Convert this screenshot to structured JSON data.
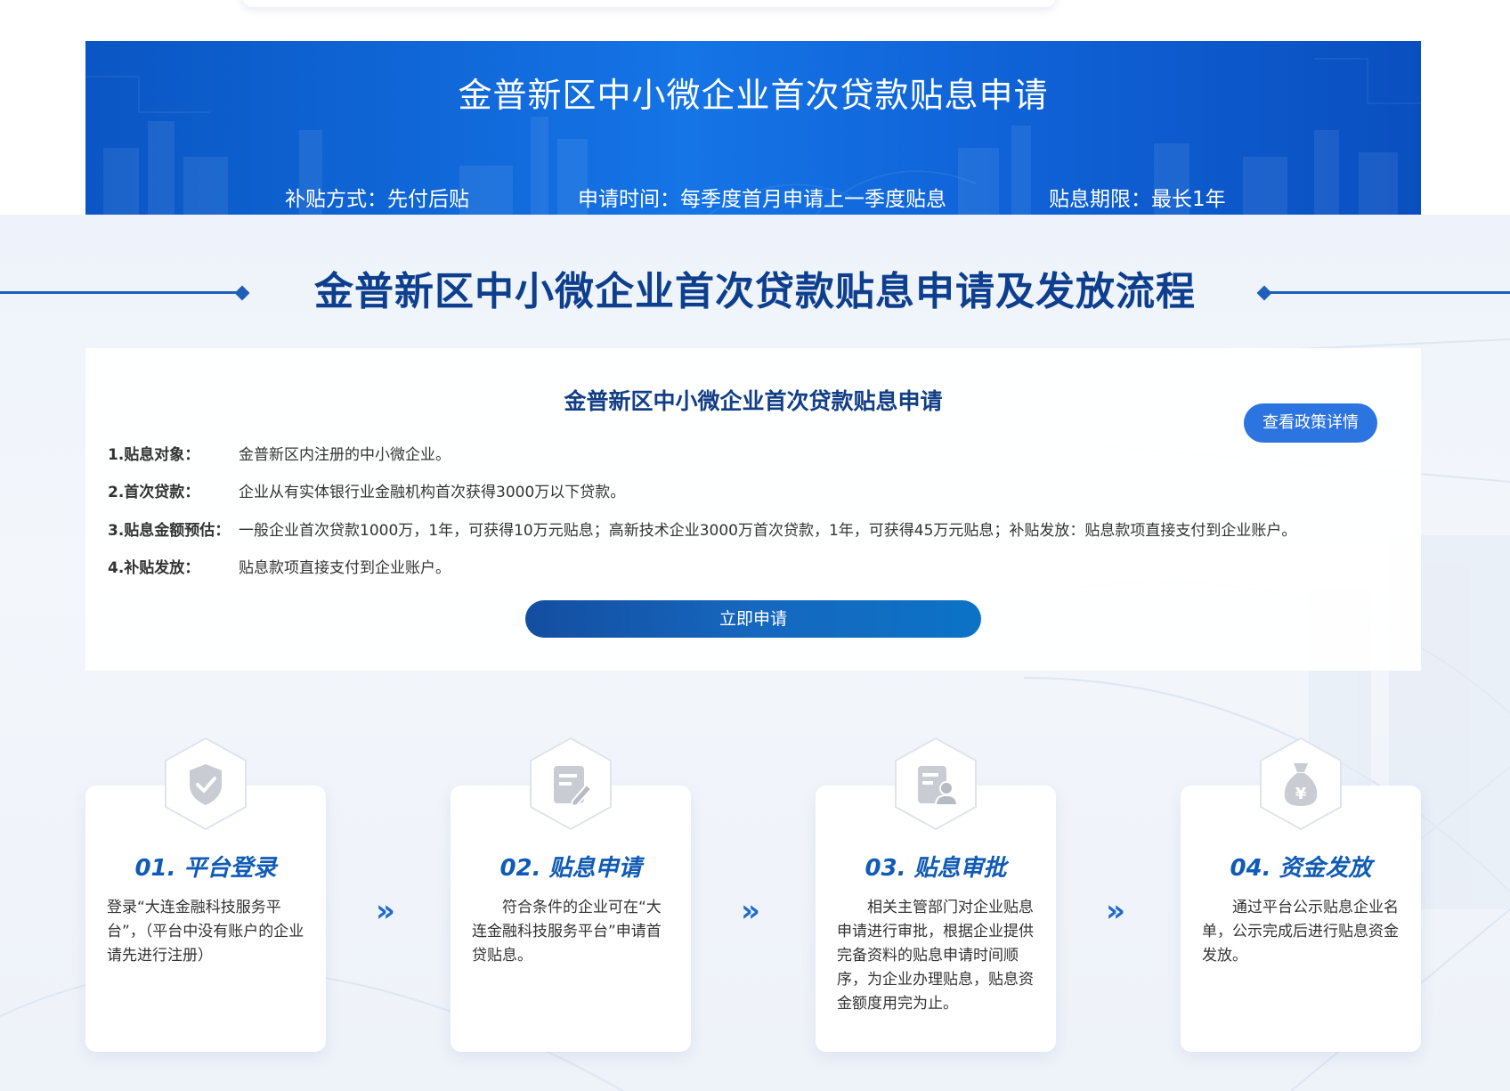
{
  "banner": {
    "title": "金普新区中小微企业首次贷款贴息申请",
    "subsidy_method": "补贴方式：先付后贴",
    "apply_time": "申请时间：每季度首月申请上一季度贴息",
    "interest_period": "贴息期限：最长1年"
  },
  "section": {
    "title": "金普新区中小微企业首次贷款贴息申请及发放流程"
  },
  "info": {
    "title": "金普新区中小微企业首次贷款贴息申请",
    "policy_button": "查看政策详情",
    "rows": [
      {
        "label": "1.贴息对象：",
        "value": "金普新区内注册的中小微企业。"
      },
      {
        "label": "2.首次贷款：",
        "value": "企业从有实体银行业金融机构首次获得3000万以下贷款。"
      },
      {
        "label": "3.贴息金额预估：",
        "value": "一般企业首次贷款1000万，1年，可获得10万元贴息；高新技术企业3000万首次贷款，1年，可获得45万元贴息；补贴发放：贴息款项直接支付到企业账户。"
      },
      {
        "label": "4.补贴发放：",
        "value": "贴息款项直接支付到企业账户。"
      }
    ],
    "apply_button": "立即申请"
  },
  "steps": [
    {
      "title": "01. 平台登录",
      "desc": "登录“大连金融科技服务平台”，（平台中没有账户的企业请先进行注册）",
      "icon": "shield-check-icon"
    },
    {
      "title": "02. 贴息申请",
      "desc": "　　符合条件的企业可在“大连金融科技服务平台”申请首贷贴息。",
      "icon": "document-edit-icon"
    },
    {
      "title": "03. 贴息审批",
      "desc": "　　相关主管部门对企业贴息申请进行审批，根据企业提供完备资料的贴息申请时间顺序，为企业办理贴息，贴息资金额度用完为止。",
      "icon": "document-user-icon"
    },
    {
      "title": "04. 资金发放",
      "desc": "　　通过平台公示贴息企业名单，公示完成后进行贴息资金发放。",
      "icon": "money-bag-icon"
    }
  ],
  "colors": {
    "banner_blue": "#1574e6",
    "title_navy": "#0d3f8e",
    "step_title_blue": "#0f5bb5",
    "button_blue": "#2c74e0"
  }
}
